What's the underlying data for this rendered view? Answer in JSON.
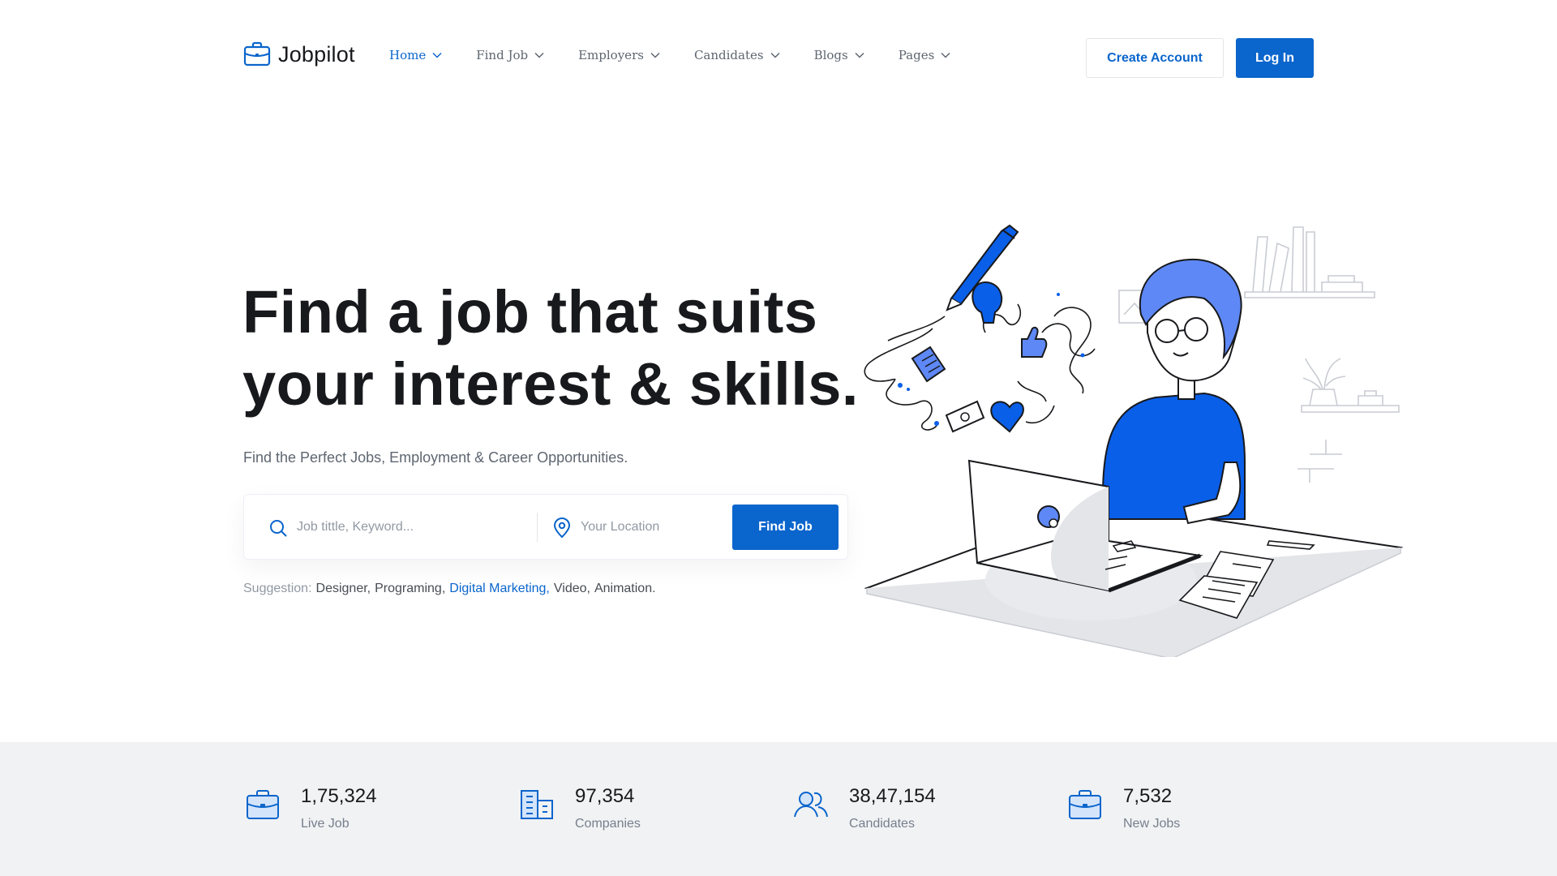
{
  "brand": {
    "name": "Jobpilot"
  },
  "nav": {
    "items": [
      {
        "label": "Home",
        "active": true
      },
      {
        "label": "Find Job",
        "active": false
      },
      {
        "label": "Employers",
        "active": false
      },
      {
        "label": "Candidates",
        "active": false
      },
      {
        "label": "Blogs",
        "active": false
      },
      {
        "label": "Pages",
        "active": false
      }
    ],
    "create_account": "Create Account",
    "login": "Log In"
  },
  "hero": {
    "title_line1": "Find a job that suits",
    "title_line2": "your interest & skills.",
    "subtitle": "Find the Perfect Jobs, Employment & Career Opportunities."
  },
  "search": {
    "keyword_placeholder": "Job tittle, Keyword...",
    "keyword_value": "",
    "location_placeholder": "Your Location",
    "location_value": "",
    "button": "Find Job"
  },
  "suggestion": {
    "label": "Suggestion:",
    "tags": [
      "Designer,",
      "Programing,",
      "Digital Marketing,",
      "Video,",
      "Animation."
    ],
    "highlighted_index": 2
  },
  "stats": [
    {
      "value": "1,75,324",
      "label": "Live Job",
      "icon": "briefcase-icon"
    },
    {
      "value": "97,354",
      "label": "Companies",
      "icon": "buildings-icon"
    },
    {
      "value": "38,47,154",
      "label": "Candidates",
      "icon": "users-icon"
    },
    {
      "value": "7,532",
      "label": "New Jobs",
      "icon": "briefcase-icon"
    }
  ],
  "colors": {
    "primary": "#0A65CC",
    "text_dark": "#18191C",
    "text_muted": "#5E6670",
    "stats_bg": "#F1F2F4",
    "illustration_blue": "#0A5FE8"
  }
}
